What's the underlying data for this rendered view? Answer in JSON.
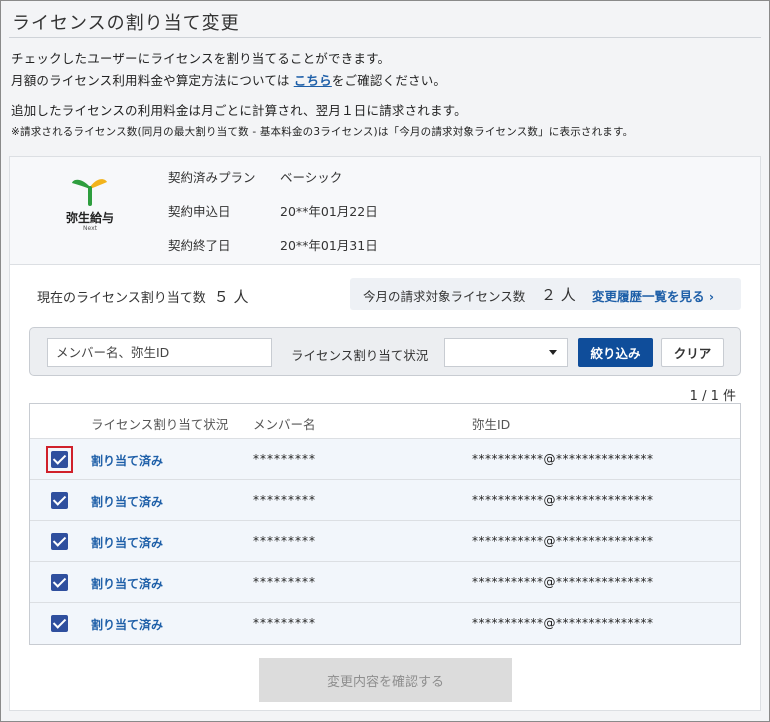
{
  "page": {
    "title": "ライセンスの割り当て変更",
    "desc_line1": "チェックしたユーザーにライセンスを割り当てることができます。",
    "desc_line2_pre": "月額のライセンス利用料金や算定方法については ",
    "desc_line2_link": "こちら",
    "desc_line2_post": "をご確認ください。",
    "desc_line3": "追加したライセンスの利用料金は月ごとに計算され、翌月１日に請求されます。",
    "desc_note": "※請求されるライセンス数(同月の最大割り当て数 - 基本料金の3ライセンス)は「今月の請求対象ライセンス数」に表示されます。"
  },
  "plan": {
    "logo_text": "弥生給与",
    "logo_sub": "Next",
    "rows": [
      {
        "label": "契約済みプラン",
        "value": "ベーシック"
      },
      {
        "label": "契約申込日",
        "value": "20**年01月22日"
      },
      {
        "label": "契約終了日",
        "value": "20**年01月31日"
      }
    ]
  },
  "summary": {
    "current_label": "現在のライセンス割り当て数",
    "current_value": "５ 人",
    "billing_label": "今月の請求対象ライセンス数",
    "billing_value": "２ 人",
    "history_link": "変更履歴一覧を見る ›"
  },
  "filter": {
    "search_placeholder": "メンバー名、弥生ID",
    "status_label": "ライセンス割り当て状況",
    "status_selected": "",
    "filter_button": "絞り込み",
    "clear_button": "クリア"
  },
  "pager": "1 / 1 件",
  "table": {
    "headers": {
      "status": "ライセンス割り当て状況",
      "member": "メンバー名",
      "yid": "弥生ID"
    },
    "rows": [
      {
        "checked": true,
        "status": "割り当て済み",
        "member": "*********",
        "yid": "***********@***************"
      },
      {
        "checked": true,
        "status": "割り当て済み",
        "member": "*********",
        "yid": "***********@***************"
      },
      {
        "checked": true,
        "status": "割り当て済み",
        "member": "*********",
        "yid": "***********@***************"
      },
      {
        "checked": true,
        "status": "割り当て済み",
        "member": "*********",
        "yid": "***********@***************"
      },
      {
        "checked": true,
        "status": "割り当て済み",
        "member": "*********",
        "yid": "***********@***************"
      }
    ]
  },
  "confirm_button": "変更内容を確認する",
  "colors": {
    "primary": "#0f4d9a",
    "link": "#1e5fa8",
    "checkbox": "#2f4f9e",
    "highlight": "#d0202a"
  }
}
